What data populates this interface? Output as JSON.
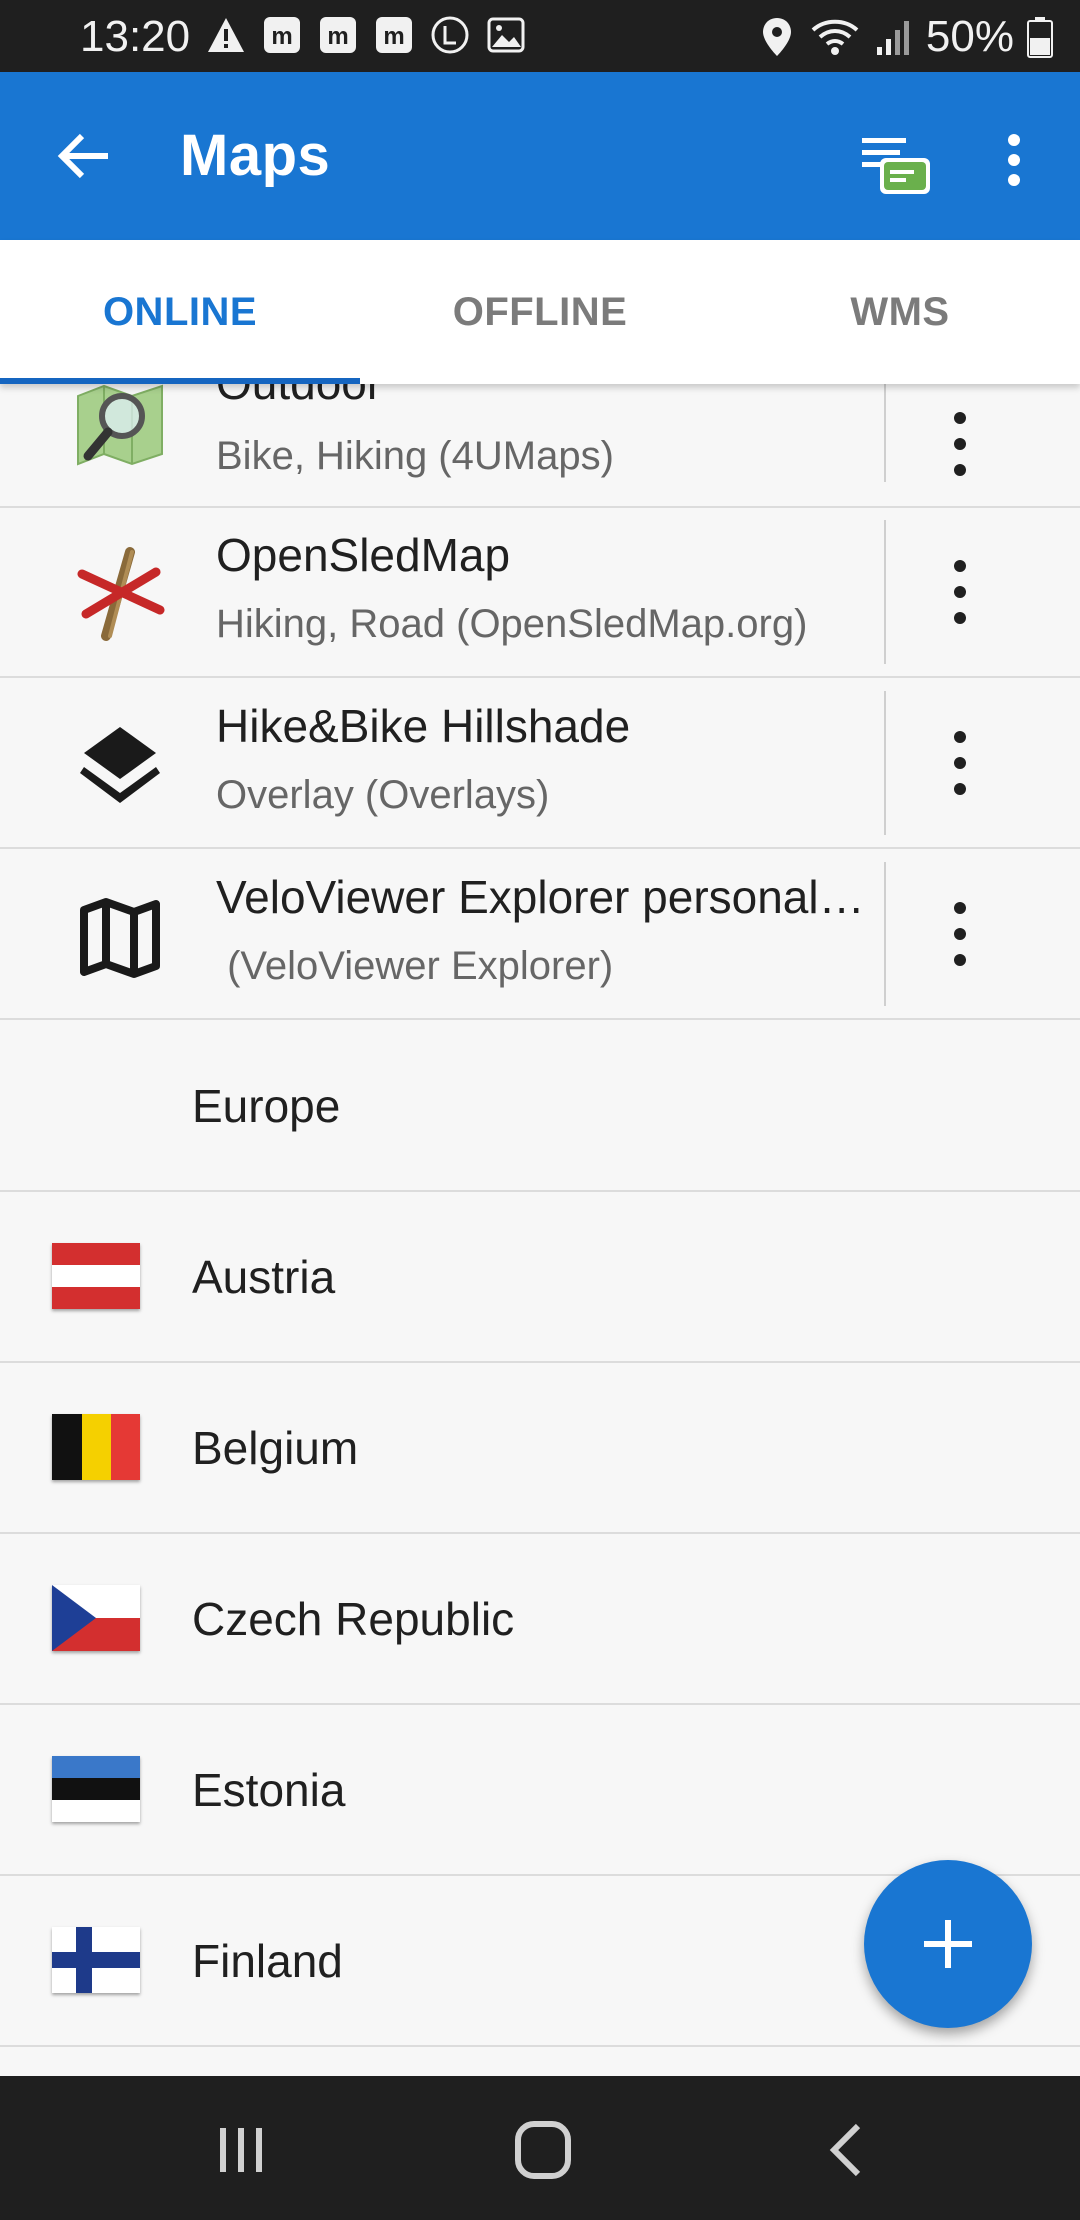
{
  "status_bar": {
    "time": "13:20",
    "left_icons": [
      "warning-icon",
      "m-icon",
      "m-icon",
      "m-icon",
      "l-circle-icon",
      "image-icon"
    ],
    "right_icons": [
      "location-icon",
      "wifi-icon",
      "signal-icon"
    ],
    "battery_percent": "50%"
  },
  "app_bar": {
    "title": "Maps",
    "background": "#1976d2"
  },
  "tabs": [
    {
      "label": "ONLINE",
      "active": true
    },
    {
      "label": "OFFLINE",
      "active": false
    },
    {
      "label": "WMS",
      "active": false
    }
  ],
  "map_items": [
    {
      "name": "Outdoor",
      "subtitle": "Bike, Hiking (4UMaps)",
      "icon": "magnifier-map-icon"
    },
    {
      "name": "OpenSledMap",
      "subtitle": "Hiking, Road (OpenSledMap.org)",
      "icon": "sled-icon"
    },
    {
      "name": "Hike&Bike Hillshade",
      "subtitle": "Overlay (Overlays)",
      "icon": "layers-icon"
    },
    {
      "name": "VeloViewer Explorer personal…",
      "subtitle": " (VeloViewer Explorer)",
      "icon": "map-icon"
    }
  ],
  "section_header": "Europe",
  "countries": [
    {
      "name": "Austria",
      "flag": "austria-flag-icon"
    },
    {
      "name": "Belgium",
      "flag": "belgium-flag-icon"
    },
    {
      "name": "Czech Republic",
      "flag": "czech-flag-icon"
    },
    {
      "name": "Estonia",
      "flag": "estonia-flag-icon"
    },
    {
      "name": "Finland",
      "flag": "finland-flag-icon"
    }
  ],
  "fab": {
    "icon": "plus-icon"
  },
  "nav_bar": {
    "buttons": [
      "recents-icon",
      "home-icon",
      "back-nav-icon"
    ]
  }
}
